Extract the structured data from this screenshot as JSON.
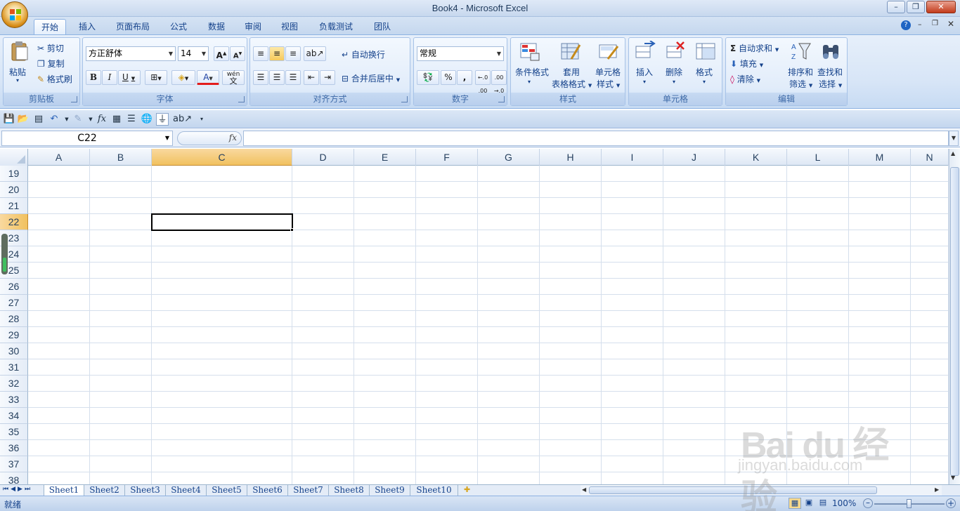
{
  "window": {
    "title": "Book4 - Microsoft Excel"
  },
  "ribbon_tabs": [
    "开始",
    "插入",
    "页面布局",
    "公式",
    "数据",
    "审阅",
    "视图",
    "负载测试",
    "团队"
  ],
  "groups": {
    "clipboard": {
      "caption": "剪贴板",
      "paste": "粘贴",
      "cut": "剪切",
      "copy": "复制",
      "format_painter": "格式刷"
    },
    "font": {
      "caption": "字体",
      "font_name": "方正舒体",
      "font_size": "14",
      "bold": "B",
      "italic": "I",
      "underline": "U",
      "grow": "A",
      "shrink": "A",
      "wen": "wén",
      "wen2": "文",
      "fontcolor_label": "A"
    },
    "alignment": {
      "caption": "对齐方式",
      "wrap": "自动换行",
      "merge": "合并后居中"
    },
    "number": {
      "caption": "数字",
      "format": "常规",
      "percent": "%",
      "comma": ",",
      "inc": "←.0 .00",
      "dec": ".00 →.0"
    },
    "styles": {
      "caption": "样式",
      "cond_format": "条件格式",
      "table_format_1": "套用",
      "table_format_2": "表格格式",
      "cell_style_1": "单元格",
      "cell_style_2": "样式"
    },
    "cells": {
      "caption": "单元格",
      "insert": "插入",
      "delete": "删除",
      "format": "格式"
    },
    "editing": {
      "caption": "编辑",
      "autosum": "自动求和",
      "fill": "填充",
      "clear": "清除",
      "sort_1": "排序和",
      "sort_2": "筛选",
      "find_1": "查找和",
      "find_2": "选择",
      "sigma": "Σ"
    }
  },
  "formula_bar": {
    "name_box": "C22",
    "fx": "fx",
    "value": ""
  },
  "columns": [
    "A",
    "B",
    "C",
    "D",
    "E",
    "F",
    "G",
    "H",
    "I",
    "J",
    "K",
    "L",
    "M",
    "N"
  ],
  "rows": [
    "19",
    "20",
    "21",
    "22",
    "23",
    "24",
    "25",
    "26",
    "27",
    "28",
    "29",
    "30",
    "31",
    "32",
    "33",
    "34",
    "35",
    "36",
    "37",
    "38"
  ],
  "selected": {
    "column": "C",
    "row": "22"
  },
  "sheets": [
    "Sheet1",
    "Sheet2",
    "Sheet3",
    "Sheet4",
    "Sheet5",
    "Sheet6",
    "Sheet7",
    "Sheet8",
    "Sheet9",
    "Sheet10"
  ],
  "active_sheet": "Sheet1",
  "status": {
    "text": "就绪",
    "zoom": "100%",
    "zoom_fraction": 0.5
  },
  "watermark": {
    "brand": "Bai du 经验",
    "url": "jingyan.baidu.com"
  },
  "colors": {
    "accent": "#15428b",
    "selected_header": "#f1c15f",
    "grid_line": "#d5dfec"
  }
}
